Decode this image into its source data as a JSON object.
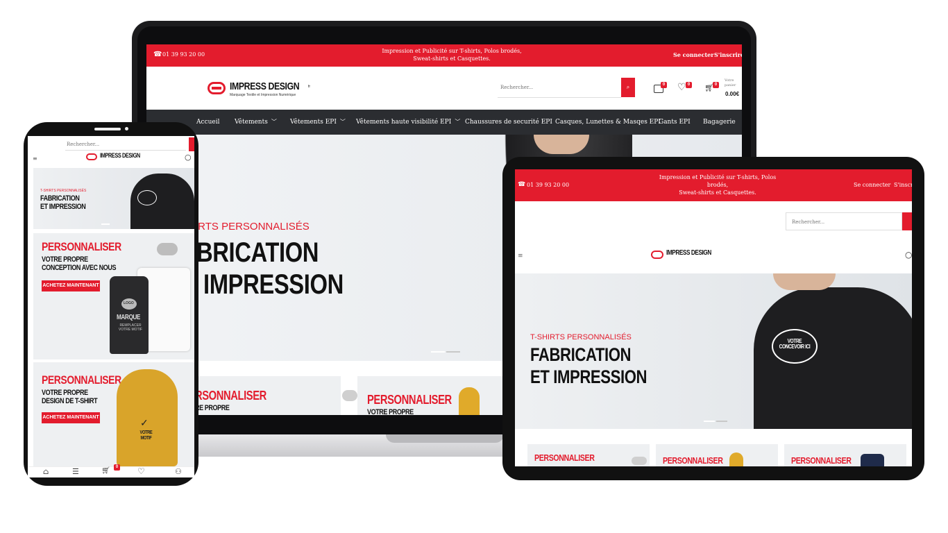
{
  "brand": {
    "name": "IMPRESS DESIGN",
    "suffix": "fr",
    "tagline": "Marquage Textile et Impression Numérique",
    "accent": "#e31c2d",
    "nav_bg": "#2b2d31"
  },
  "topbar": {
    "phone": "01 39 93 20 00",
    "promo_line1": "Impression et Publicité sur T-shirts, Polos brodés,",
    "promo_line2": "Sweat-shirts et Casquettes.",
    "login": "Se connecter",
    "register": "S'inscrire"
  },
  "header": {
    "search_placeholder": "Rechercher...",
    "compare_count": "0",
    "wishlist_count": "0",
    "cart_count": "0",
    "cart_label": "Votre panier",
    "cart_total": "0.00€"
  },
  "nav": [
    {
      "label": "Accueil",
      "has_menu": false
    },
    {
      "label": "Vêtements",
      "has_menu": true
    },
    {
      "label": "Vêtements EPI",
      "has_menu": true
    },
    {
      "label": "Vêtements haute visibilité EPI",
      "has_menu": true
    },
    {
      "label": "Chaussures de securité EPI",
      "has_menu": false
    },
    {
      "label": "Casques, Lunettes & Masqes EPI",
      "has_menu": false
    },
    {
      "label": "Gants EPI",
      "has_menu": false
    },
    {
      "label": "Bagagerie",
      "has_menu": false
    }
  ],
  "hero": {
    "kicker": "T-SHIRTS PERSONNALISÉS",
    "line1": "FABRICATION",
    "line2": "ET IMPRESSION",
    "shirt_print": "VOTRE CONCEVOIR ICI",
    "laptop_kicker_visible": "IRTS PERSONNALISÉS",
    "laptop_line1_visible": "BRICATION",
    "laptop_line2_visible": "IMPRESSION"
  },
  "promos": [
    {
      "title": "PERSONNALISER",
      "subtitle": "VOTRE PROPRE CONCEPTION AVEC NOUS",
      "sub_line1": "VOTRE PROPRE",
      "sub_line2": "CONCEPTION AVEC NOUS",
      "button": "ACHETEZ MAINTENANT",
      "product_text": "MARQUE",
      "product_text2": "REMPLACER VOTRE MOTIF",
      "logo_text": "LOGO"
    },
    {
      "title": "PERSONNALISER",
      "subtitle": "VOTRE PROPRE DESIGN DE T-SHIRT",
      "sub_line1": "VOTRE PROPRE",
      "sub_line2": "DESIGN DE T-SHIRT",
      "button": "ACHETEZ MAINTENANT",
      "product_text": "VOTRE MOTIF"
    },
    {
      "title": "PERSONNALISER"
    }
  ],
  "laptop_promos_visible": {
    "left_title": "RSONNALISER",
    "left_sub": "RE PROPRE",
    "right_title": "PERSONNALISER",
    "right_sub": "VOTRE PROPRE"
  },
  "phone": {
    "search_placeholder": "Rechercher...",
    "hero_kicker": "T-SHIRTS PERSONNALISÉS",
    "hero_line1": "FABRICATION",
    "hero_line2": "ET IMPRESSION",
    "cart_count": "0"
  }
}
